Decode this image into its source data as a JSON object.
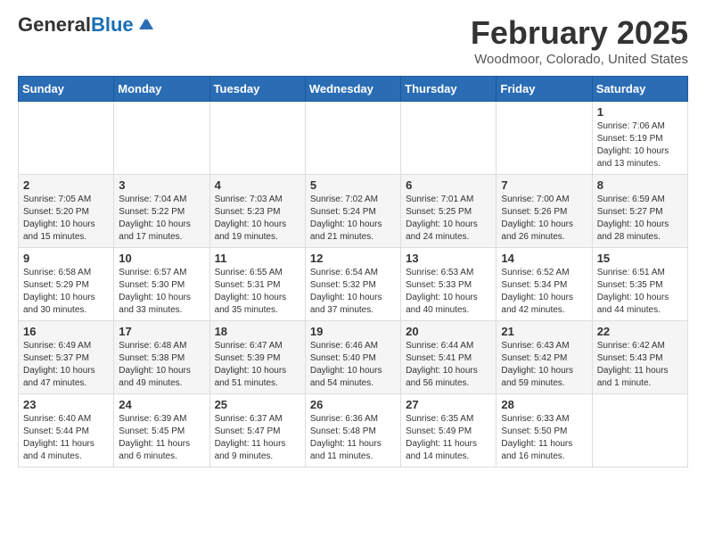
{
  "header": {
    "logo_general": "General",
    "logo_blue": "Blue",
    "month_title": "February 2025",
    "location": "Woodmoor, Colorado, United States"
  },
  "weekdays": [
    "Sunday",
    "Monday",
    "Tuesday",
    "Wednesday",
    "Thursday",
    "Friday",
    "Saturday"
  ],
  "weeks": [
    [
      {
        "day": "",
        "info": ""
      },
      {
        "day": "",
        "info": ""
      },
      {
        "day": "",
        "info": ""
      },
      {
        "day": "",
        "info": ""
      },
      {
        "day": "",
        "info": ""
      },
      {
        "day": "",
        "info": ""
      },
      {
        "day": "1",
        "info": "Sunrise: 7:06 AM\nSunset: 5:19 PM\nDaylight: 10 hours\nand 13 minutes."
      }
    ],
    [
      {
        "day": "2",
        "info": "Sunrise: 7:05 AM\nSunset: 5:20 PM\nDaylight: 10 hours\nand 15 minutes."
      },
      {
        "day": "3",
        "info": "Sunrise: 7:04 AM\nSunset: 5:22 PM\nDaylight: 10 hours\nand 17 minutes."
      },
      {
        "day": "4",
        "info": "Sunrise: 7:03 AM\nSunset: 5:23 PM\nDaylight: 10 hours\nand 19 minutes."
      },
      {
        "day": "5",
        "info": "Sunrise: 7:02 AM\nSunset: 5:24 PM\nDaylight: 10 hours\nand 21 minutes."
      },
      {
        "day": "6",
        "info": "Sunrise: 7:01 AM\nSunset: 5:25 PM\nDaylight: 10 hours\nand 24 minutes."
      },
      {
        "day": "7",
        "info": "Sunrise: 7:00 AM\nSunset: 5:26 PM\nDaylight: 10 hours\nand 26 minutes."
      },
      {
        "day": "8",
        "info": "Sunrise: 6:59 AM\nSunset: 5:27 PM\nDaylight: 10 hours\nand 28 minutes."
      }
    ],
    [
      {
        "day": "9",
        "info": "Sunrise: 6:58 AM\nSunset: 5:29 PM\nDaylight: 10 hours\nand 30 minutes."
      },
      {
        "day": "10",
        "info": "Sunrise: 6:57 AM\nSunset: 5:30 PM\nDaylight: 10 hours\nand 33 minutes."
      },
      {
        "day": "11",
        "info": "Sunrise: 6:55 AM\nSunset: 5:31 PM\nDaylight: 10 hours\nand 35 minutes."
      },
      {
        "day": "12",
        "info": "Sunrise: 6:54 AM\nSunset: 5:32 PM\nDaylight: 10 hours\nand 37 minutes."
      },
      {
        "day": "13",
        "info": "Sunrise: 6:53 AM\nSunset: 5:33 PM\nDaylight: 10 hours\nand 40 minutes."
      },
      {
        "day": "14",
        "info": "Sunrise: 6:52 AM\nSunset: 5:34 PM\nDaylight: 10 hours\nand 42 minutes."
      },
      {
        "day": "15",
        "info": "Sunrise: 6:51 AM\nSunset: 5:35 PM\nDaylight: 10 hours\nand 44 minutes."
      }
    ],
    [
      {
        "day": "16",
        "info": "Sunrise: 6:49 AM\nSunset: 5:37 PM\nDaylight: 10 hours\nand 47 minutes."
      },
      {
        "day": "17",
        "info": "Sunrise: 6:48 AM\nSunset: 5:38 PM\nDaylight: 10 hours\nand 49 minutes."
      },
      {
        "day": "18",
        "info": "Sunrise: 6:47 AM\nSunset: 5:39 PM\nDaylight: 10 hours\nand 51 minutes."
      },
      {
        "day": "19",
        "info": "Sunrise: 6:46 AM\nSunset: 5:40 PM\nDaylight: 10 hours\nand 54 minutes."
      },
      {
        "day": "20",
        "info": "Sunrise: 6:44 AM\nSunset: 5:41 PM\nDaylight: 10 hours\nand 56 minutes."
      },
      {
        "day": "21",
        "info": "Sunrise: 6:43 AM\nSunset: 5:42 PM\nDaylight: 10 hours\nand 59 minutes."
      },
      {
        "day": "22",
        "info": "Sunrise: 6:42 AM\nSunset: 5:43 PM\nDaylight: 11 hours\nand 1 minute."
      }
    ],
    [
      {
        "day": "23",
        "info": "Sunrise: 6:40 AM\nSunset: 5:44 PM\nDaylight: 11 hours\nand 4 minutes."
      },
      {
        "day": "24",
        "info": "Sunrise: 6:39 AM\nSunset: 5:45 PM\nDaylight: 11 hours\nand 6 minutes."
      },
      {
        "day": "25",
        "info": "Sunrise: 6:37 AM\nSunset: 5:47 PM\nDaylight: 11 hours\nand 9 minutes."
      },
      {
        "day": "26",
        "info": "Sunrise: 6:36 AM\nSunset: 5:48 PM\nDaylight: 11 hours\nand 11 minutes."
      },
      {
        "day": "27",
        "info": "Sunrise: 6:35 AM\nSunset: 5:49 PM\nDaylight: 11 hours\nand 14 minutes."
      },
      {
        "day": "28",
        "info": "Sunrise: 6:33 AM\nSunset: 5:50 PM\nDaylight: 11 hours\nand 16 minutes."
      },
      {
        "day": "",
        "info": ""
      }
    ]
  ]
}
